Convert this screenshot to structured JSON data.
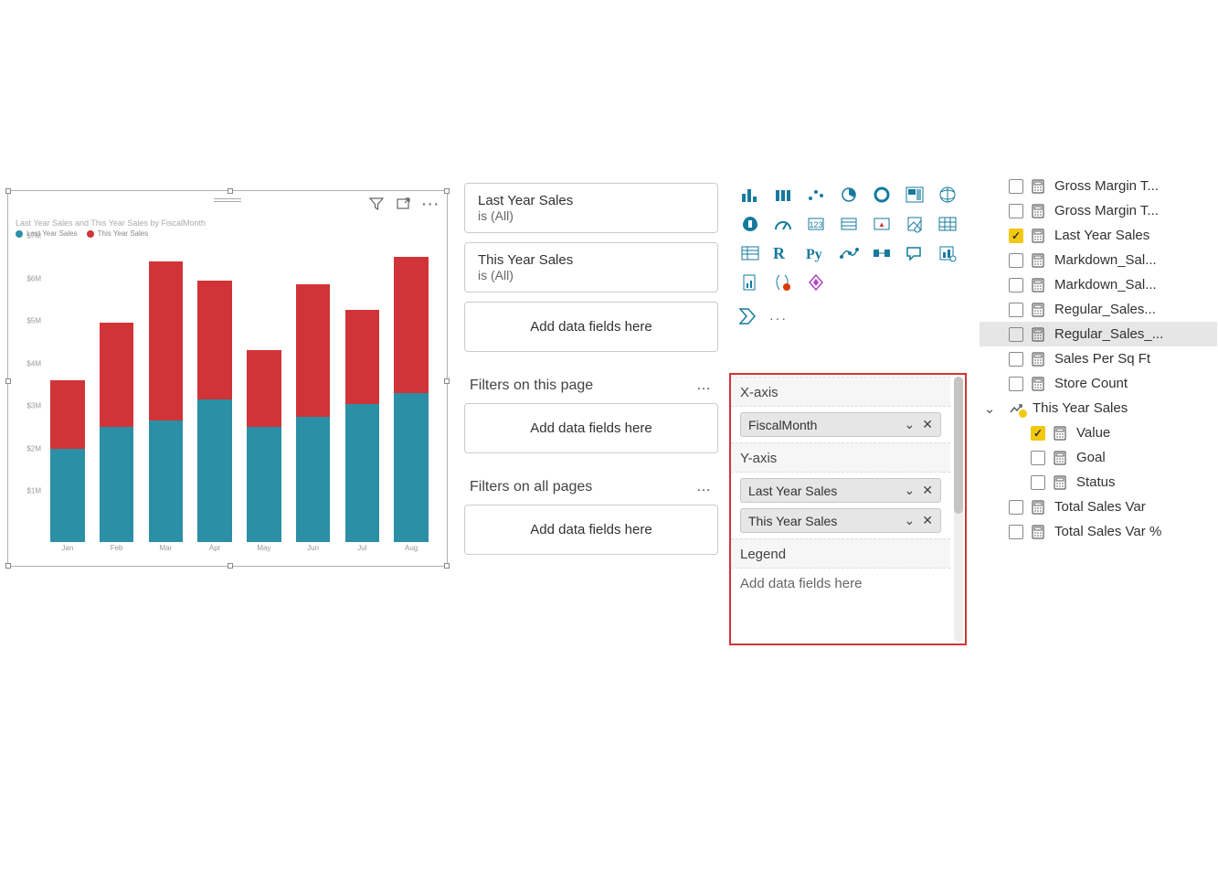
{
  "chart_data": {
    "type": "bar",
    "title": "Last Year Sales and This Year Sales by FiscalMonth",
    "legend": [
      {
        "name": "Last Year Sales",
        "color": "#2b8fa5"
      },
      {
        "name": "This Year Sales",
        "color": "#d13438"
      }
    ],
    "categories": [
      "Jan",
      "Feb",
      "Mar",
      "Apr",
      "May",
      "Jun",
      "Jul",
      "Aug"
    ],
    "series": [
      {
        "name": "Last Year Sales",
        "values": [
          2.2,
          2.7,
          2.85,
          3.35,
          2.7,
          2.95,
          3.25,
          3.5
        ]
      },
      {
        "name": "This Year Sales",
        "values": [
          1.6,
          2.45,
          3.75,
          2.8,
          1.8,
          3.1,
          2.2,
          3.2
        ]
      }
    ],
    "ylabel": "",
    "xlabel": "",
    "ylim": [
      0,
      7
    ],
    "y_ticks": [
      "$1M",
      "$2M",
      "$3M",
      "$4M",
      "$5M",
      "$6M",
      "$7M"
    ]
  },
  "visual_header": {
    "filter_icon": "filter",
    "focus_icon": "focus-mode",
    "more_icon": "more"
  },
  "filters": {
    "visual": [
      {
        "field": "Last Year Sales",
        "summary": "is (All)"
      },
      {
        "field": "This Year Sales",
        "summary": "is (All)"
      }
    ],
    "visual_drop": "Add data fields here",
    "page_title": "Filters on this page",
    "page_drop": "Add data fields here",
    "all_title": "Filters on all pages",
    "all_drop": "Add data fields here"
  },
  "wells": {
    "xaxis_label": "X-axis",
    "xaxis_item": "FiscalMonth",
    "yaxis_label": "Y-axis",
    "yaxis_items": [
      "Last Year Sales",
      "This Year Sales"
    ],
    "legend_label": "Legend",
    "legend_drop": "Add data fields here"
  },
  "fields": [
    {
      "name": "Gross Margin T...",
      "checked": false,
      "icon": "calc"
    },
    {
      "name": "Gross Margin T...",
      "checked": false,
      "icon": "calc"
    },
    {
      "name": "Last Year Sales",
      "checked": true,
      "icon": "calc"
    },
    {
      "name": "Markdown_Sal...",
      "checked": false,
      "icon": "calc"
    },
    {
      "name": "Markdown_Sal...",
      "checked": false,
      "icon": "calc"
    },
    {
      "name": "Regular_Sales...",
      "checked": false,
      "icon": "calc"
    },
    {
      "name": "Regular_Sales_...",
      "checked": false,
      "icon": "calc",
      "hover": true
    },
    {
      "name": "Sales Per Sq Ft",
      "checked": false,
      "icon": "calc"
    },
    {
      "name": "Store Count",
      "checked": false,
      "icon": "calc"
    },
    {
      "name": "This Year Sales",
      "expandable": true,
      "icon": "trend"
    },
    {
      "name": "Value",
      "checked": true,
      "icon": "calc",
      "indent": true
    },
    {
      "name": "Goal",
      "checked": false,
      "icon": "calc",
      "indent": true
    },
    {
      "name": "Status",
      "checked": false,
      "icon": "calc",
      "indent": true
    },
    {
      "name": "Total Sales Var",
      "checked": false,
      "icon": "calc"
    },
    {
      "name": "Total Sales Var %",
      "checked": false,
      "icon": "calc"
    }
  ]
}
